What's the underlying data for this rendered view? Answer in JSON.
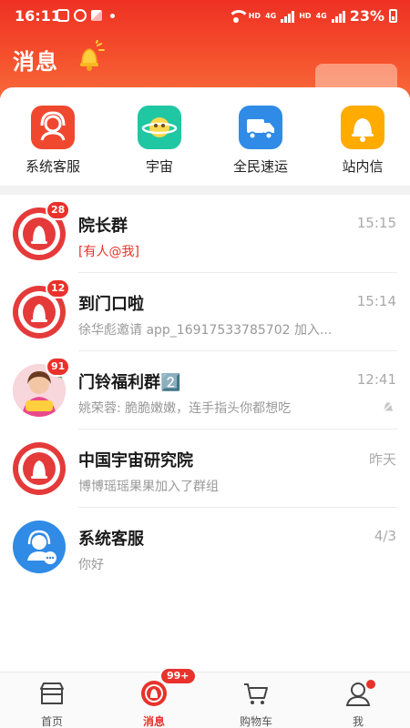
{
  "status": {
    "time": "16:11",
    "hd1": "HD",
    "hd2": "HD",
    "net1": "4G",
    "net2": "4G",
    "battery": "23%"
  },
  "header": {
    "title": "消息",
    "icon": "bell-icon"
  },
  "quick_actions": [
    {
      "label": "系统客服",
      "icon": "headset-icon",
      "color": "#f0482f"
    },
    {
      "label": "宇宙",
      "icon": "planet-icon",
      "color": "#1fc7a3"
    },
    {
      "label": "全民速运",
      "icon": "truck-icon",
      "color": "#2f8be6"
    },
    {
      "label": "站内信",
      "icon": "bell-icon",
      "color": "#ffab00"
    }
  ],
  "messages": [
    {
      "title": "院长群",
      "time": "15:15",
      "preview": "[有人@我]",
      "badge": "28",
      "avatar": "bell-avatar",
      "preview_highlight": true
    },
    {
      "title": "到门口啦",
      "time": "15:14",
      "preview": "徐华彪邀请 app_16917533785702 加入...",
      "badge": "12",
      "avatar": "bell-avatar"
    },
    {
      "title": "门铃福利群2️⃣",
      "time": "12:41",
      "preview": "姚荣蓉: 脆脆嫩嫩，连手指头你都想吃",
      "badge": "91",
      "avatar": "group-avatar",
      "muted": true
    },
    {
      "title": "中国宇宙研究院",
      "time": "昨天",
      "preview": "博博瑶瑶果果加入了群组",
      "avatar": "bell-avatar"
    },
    {
      "title": "系统客服",
      "time": "4/3",
      "preview": "你好",
      "avatar": "service-avatar"
    }
  ],
  "bottom_nav": {
    "tabs": [
      {
        "label": "首页",
        "icon": "home-icon"
      },
      {
        "label": "消息",
        "icon": "message-icon",
        "badge": "99+",
        "active": true
      },
      {
        "label": "购物车",
        "icon": "cart-icon"
      },
      {
        "label": "我",
        "icon": "profile-icon",
        "dot": true
      }
    ]
  },
  "colors": {
    "brand_red": "#e8322b",
    "header_gradient_start": "#ee3124",
    "service_blue": "#2f8be6"
  }
}
